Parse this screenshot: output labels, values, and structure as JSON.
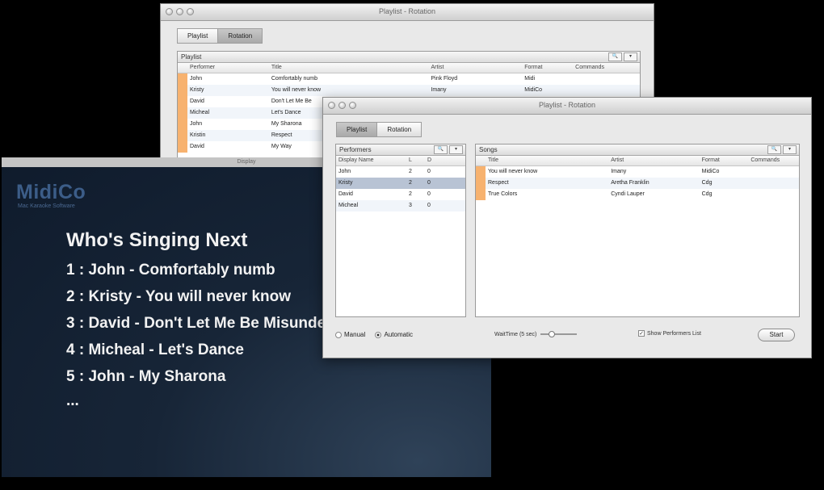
{
  "back_window": {
    "title": "Playlist - Rotation",
    "tabs": [
      "Playlist",
      "Rotation"
    ],
    "panel_title": "Playlist",
    "columns": [
      "Performer",
      "Title",
      "Artist",
      "Format",
      "Commands"
    ],
    "rows": [
      [
        "John",
        "Comfortably numb",
        "Pink Floyd",
        "Midi",
        ""
      ],
      [
        "Kristy",
        "You will never know",
        "Imany",
        "MidiCo",
        ""
      ],
      [
        "David",
        "Don't Let Me Be",
        "",
        "",
        ""
      ],
      [
        "Micheal",
        "Let's Dance",
        "",
        "",
        ""
      ],
      [
        "John",
        "My Sharona",
        "",
        "",
        ""
      ],
      [
        "Kristin",
        "Respect",
        "",
        "",
        ""
      ],
      [
        "David",
        "My Way",
        "",
        "",
        ""
      ]
    ]
  },
  "front_window": {
    "title": "Playlist - Rotation",
    "tabs": [
      "Playlist",
      "Rotation"
    ],
    "performers": {
      "title": "Performers",
      "columns": [
        "Display Name",
        "L",
        "D"
      ],
      "rows": [
        [
          "John",
          "2",
          "0"
        ],
        [
          "Kristy",
          "2",
          "0"
        ],
        [
          "David",
          "2",
          "0"
        ],
        [
          "Micheal",
          "3",
          "0"
        ]
      ]
    },
    "songs": {
      "title": "Songs",
      "columns": [
        "Title",
        "Artist",
        "Format",
        "Commands"
      ],
      "rows": [
        [
          "You will never know",
          "Imany",
          "MidiCo",
          ""
        ],
        [
          "Respect",
          "Aretha Franklin",
          "Cdg",
          ""
        ],
        [
          "True Colors",
          "Cyndi Lauper",
          "Cdg",
          ""
        ]
      ]
    },
    "manual_label": "Manual",
    "automatic_label": "Automatic",
    "wait_label": "WaitTime (5 sec)",
    "show_label": "Show Performers List",
    "start_label": "Start"
  },
  "display": {
    "title": "Display",
    "logo": "MidiCo",
    "logo_sub": "Mac Karaoke Software",
    "heading": "Who's Singing Next",
    "lines": [
      "1 : John - Comfortably numb",
      "2 : Kristy - You will never know",
      "3 : David - Don't Let Me Be Misunderstood",
      "4 : Micheal - Let's Dance",
      "5 : John - My Sharona",
      "..."
    ]
  },
  "colors": {
    "accent_orange": "#f7b26f",
    "display_bg": "#172537"
  }
}
